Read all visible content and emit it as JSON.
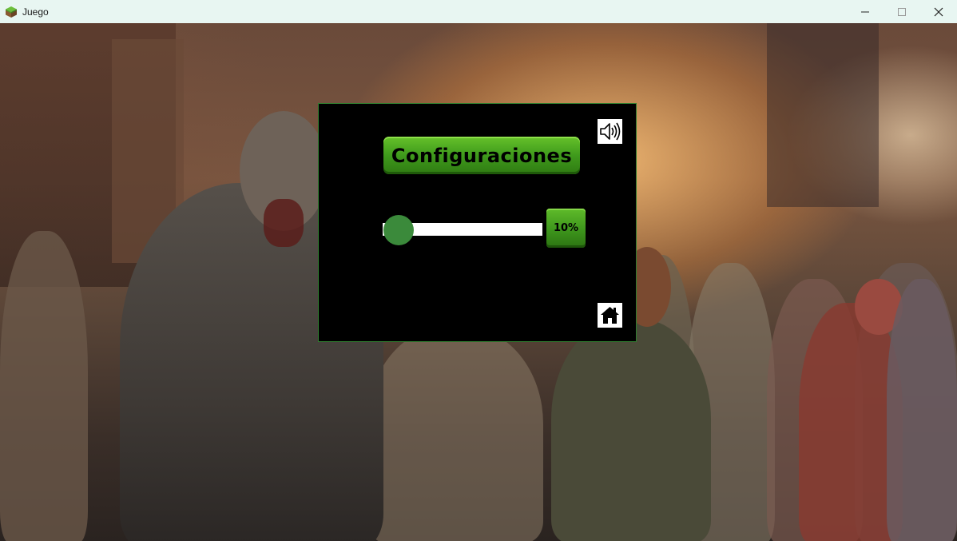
{
  "window": {
    "title": "Juego",
    "app_icon": "grass-block-icon",
    "controls": [
      "minimize-icon",
      "maximize-icon",
      "close-icon"
    ]
  },
  "background": {
    "description_icon": "zombie-crowd-image"
  },
  "settings_panel": {
    "title": "Configuraciones",
    "sound_icon": "speaker-icon",
    "home_icon": "home-icon",
    "volume": {
      "value_percent": 10,
      "label": "10%"
    }
  },
  "colors": {
    "panel_bg": "#000000",
    "panel_border": "#2f7d2f",
    "button_green": "#3f9a1c",
    "knob_green": "#3b8a3b",
    "titlebar_bg": "#e8f6f2"
  }
}
